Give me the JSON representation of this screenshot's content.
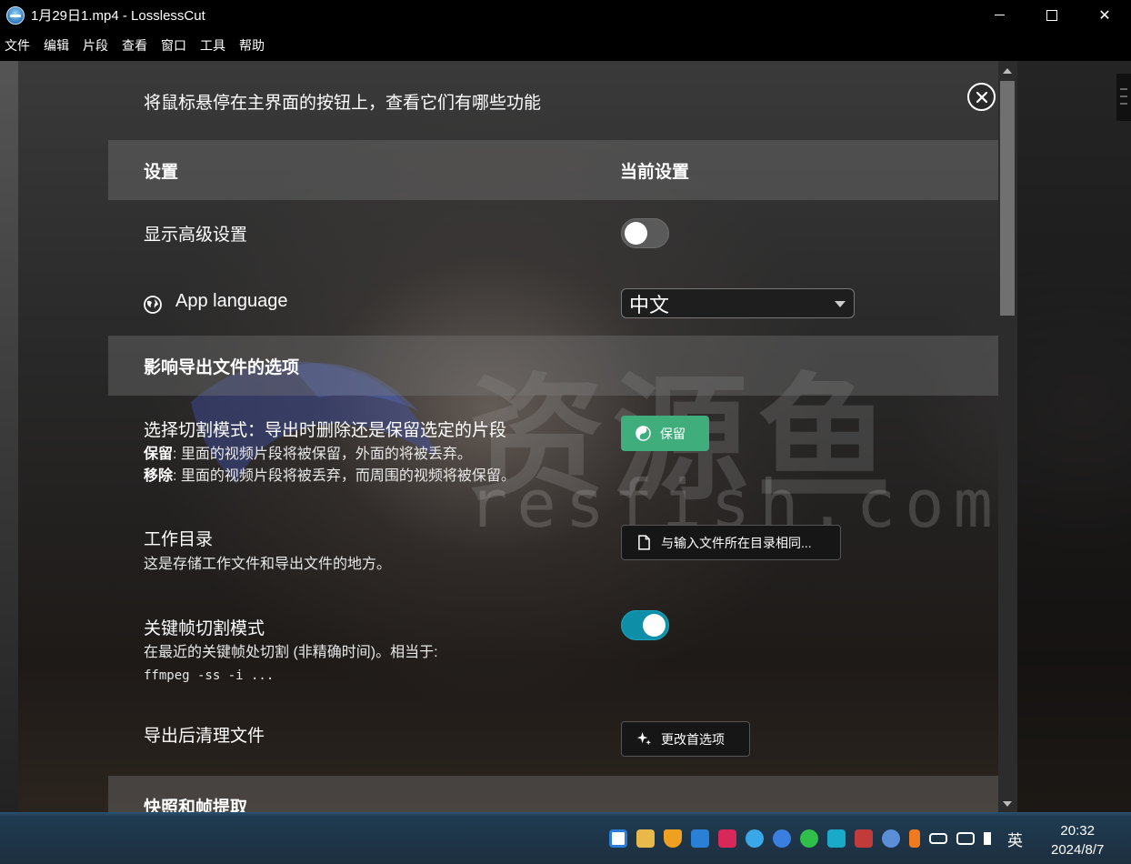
{
  "window": {
    "title": "1月29日1.mp4 - LosslessCut",
    "controls": {
      "minimize": "",
      "maximize": "",
      "close": "✕"
    }
  },
  "menu": [
    "文件",
    "编辑",
    "片段",
    "查看",
    "窗口",
    "工具",
    "帮助"
  ],
  "settings": {
    "hint": "将鼠标悬停在主界面的按钮上，查看它们有哪些功能",
    "header": {
      "left": "设置",
      "right": "当前设置"
    },
    "show_advanced": {
      "label": "显示高级设置",
      "enabled": false
    },
    "app_language": {
      "label": "App language",
      "value": "中文",
      "icon": "globe-icon"
    },
    "export_section": "影响导出文件的选项",
    "cut_mode": {
      "title": "选择切割模式：导出时删除还是保留选定的片段",
      "keep_term": "保留",
      "keep_desc": ": 里面的视频片段将被保留，外面的将被丢弃。",
      "remove_term": "移除",
      "remove_desc": ": 里面的视频片段将被丢弃，而周围的视频将被保留。",
      "button": "保留",
      "button_color": "#3fae7c"
    },
    "working_dir": {
      "title": "工作目录",
      "desc": "这是存储工作文件和导出文件的地方。",
      "button": "与输入文件所在目录相同..."
    },
    "keyframe_cut": {
      "title": "关键帧切割模式",
      "desc": "在最近的关键帧处切割 (非精确时间)。相当于:",
      "command": "ffmpeg -ss -i ...",
      "enabled": true,
      "accent": "#0f8fa7"
    },
    "cleanup": {
      "title": "导出后清理文件",
      "button": "更改首选项"
    },
    "snapshot_section": "快照和帧提取"
  },
  "watermark": {
    "text": "资源鱼",
    "sub": "resfish.com"
  },
  "taskbar": {
    "ime": "英",
    "time": "20:32",
    "date": "2024/8/7"
  }
}
